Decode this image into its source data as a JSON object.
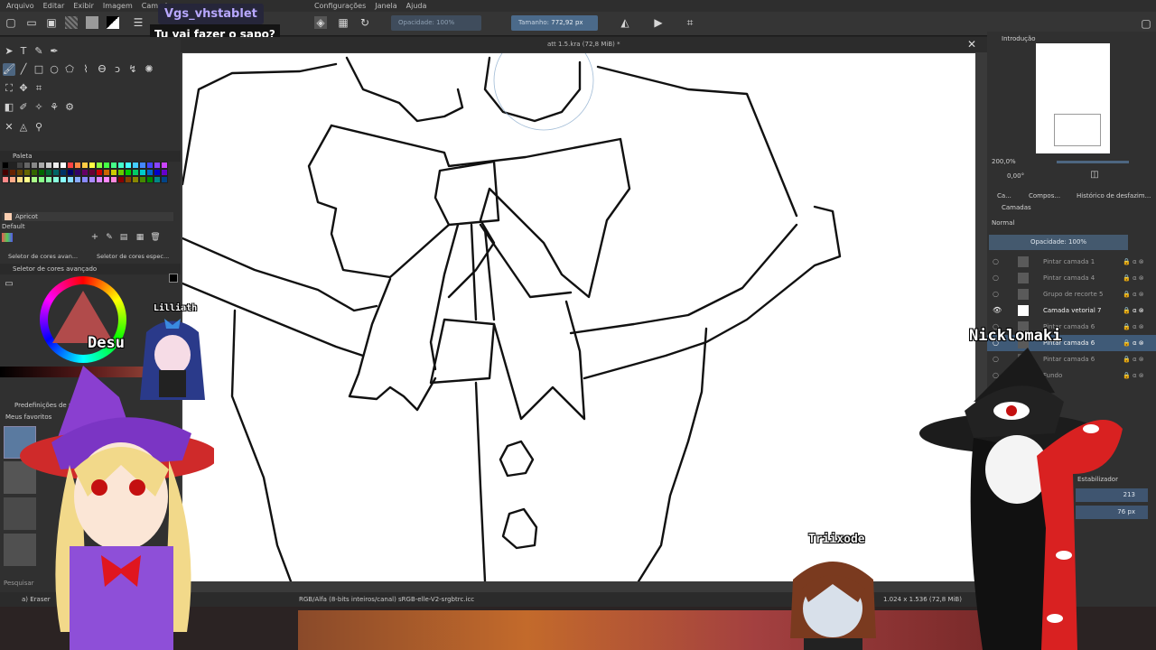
{
  "menu": [
    "Arquivo",
    "Editar",
    "Exibir",
    "Imagem",
    "Camada",
    "Configurações",
    "Janela",
    "Ajuda"
  ],
  "toolbar": {
    "opacity_label": "Opacidade: 100%",
    "size_label": "Tamanho:",
    "size_value": "772,92 px"
  },
  "chat": {
    "username": "Vgs_vhstablet",
    "message": "Tu vai fazer o sapo?"
  },
  "left_panel": {
    "palette_title": "Paleta",
    "selected_color_name": "Apricot",
    "palette_set": "Default",
    "selector_tab_1": "Seletor de cores avan...",
    "selector_tab_2": "Seletor de cores espec...",
    "advanced_selector_title": "Seletor de cores avançado",
    "presets_title": "Predefinições de pincel",
    "favorites": "Meus favoritos",
    "search_placeholder": "Pesquisar",
    "current_brush": "a) Eraser"
  },
  "document": {
    "tab_title": "att 1.5.kra (72,8 MiB) *"
  },
  "status": {
    "color_info": "RGB/Alfa (8-bits inteiros/canal)  sRGB-elle-V2-srgbtrc.icc",
    "size_info": "1.024 x 1.536 (72,8 MiB)"
  },
  "right_panel": {
    "overview_title": "Introdução",
    "zoom": "200,0%",
    "rotation": "0,00°",
    "tabs": [
      "Ca...",
      "Compos...",
      "Histórico de desfazim..."
    ],
    "layers_title": "Camadas",
    "blend_mode": "Normal",
    "opacity": "Opacidade:  100%",
    "layers": [
      {
        "name": "Pintar camada 1",
        "state": "normal"
      },
      {
        "name": "Pintar camada 4",
        "state": "normal"
      },
      {
        "name": "Grupo de recorte 5",
        "state": "normal"
      },
      {
        "name": "Camada vetorial 7",
        "state": "bright"
      },
      {
        "name": "Pintar camada 6",
        "state": "normal"
      },
      {
        "name": "Pintar camada 6",
        "state": "selected"
      },
      {
        "name": "Pintar camada 6",
        "state": "normal"
      },
      {
        "name": "Fundo",
        "state": "normal"
      }
    ],
    "stabilizer_label": "Estabilizador",
    "value_1": "213",
    "value_2": "76 px"
  },
  "avatars": {
    "left_name_1": "Lilliath",
    "left_name_2": "Desu",
    "right_name": "Nicklomaki",
    "bottom_name": "Triixode"
  },
  "colors": {
    "accent": "#4d6681",
    "selected_layer": "#3f5a77",
    "chat_name": "#b8a8ff"
  }
}
